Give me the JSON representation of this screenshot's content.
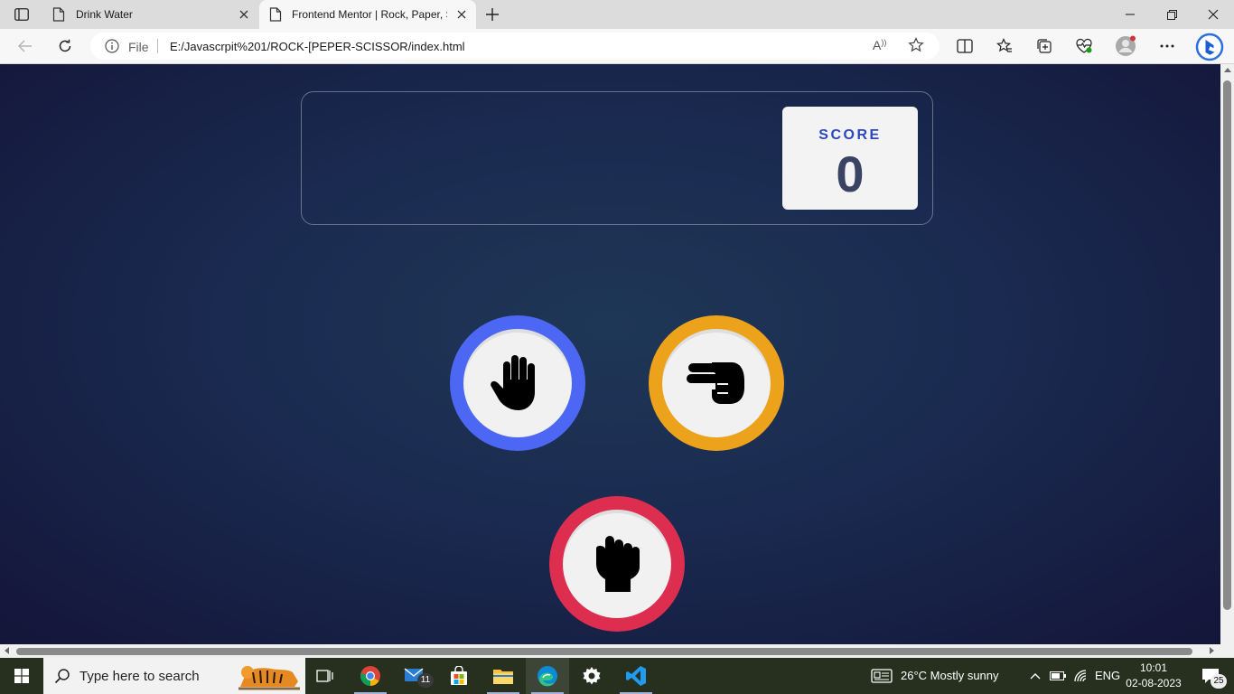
{
  "browser": {
    "tabs": [
      {
        "title": "Drink Water",
        "active": false
      },
      {
        "title": "Frontend Mentor | Rock, Paper, S",
        "active": true
      }
    ],
    "address": {
      "scheme_label": "File",
      "url": "E:/Javascrpit%201/ROCK-[PEPER-SCISSOR/index.html"
    }
  },
  "page": {
    "score_label": "SCORE",
    "score_value": "0",
    "choices": [
      {
        "name": "paper",
        "color": "#4c67f3"
      },
      {
        "name": "scissors",
        "color": "#eca21b"
      },
      {
        "name": "rock",
        "color": "#dd2e50"
      }
    ]
  },
  "taskbar": {
    "search_placeholder": "Type here to search",
    "mail_badge": "11",
    "weather": "26°C  Mostly sunny",
    "language": "ENG",
    "time": "10:01",
    "date": "02-08-2023",
    "notifications": "25"
  }
}
